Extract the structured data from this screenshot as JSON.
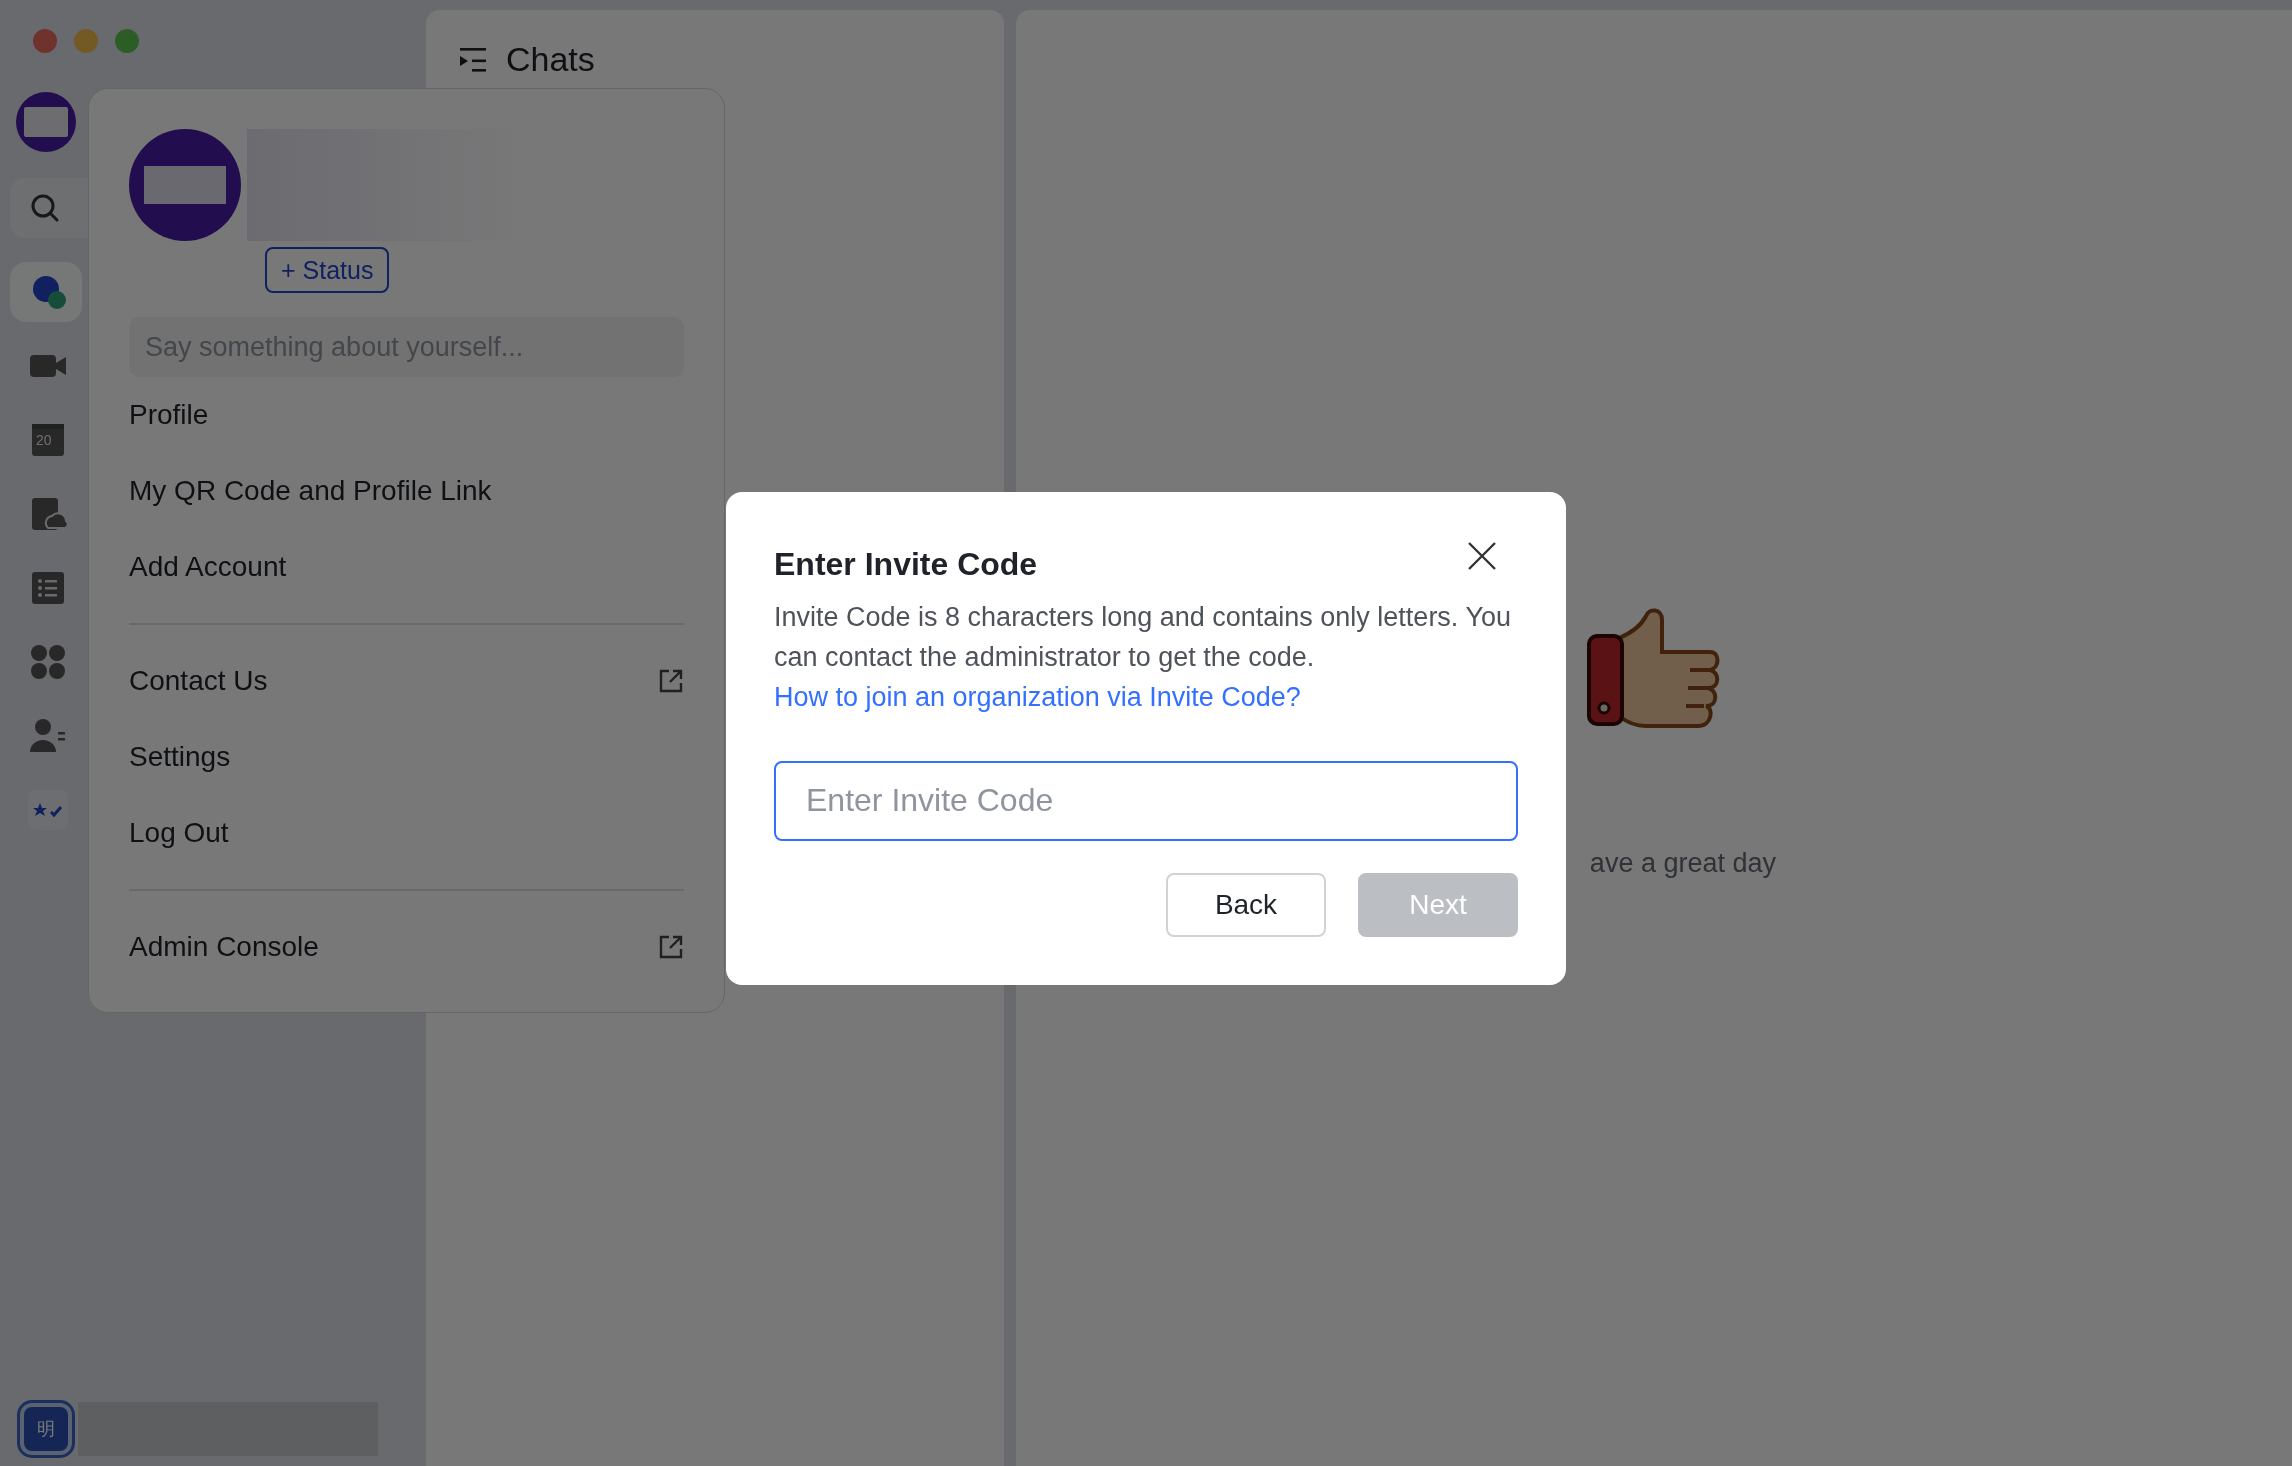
{
  "sidebar": {
    "nav_items": [
      {
        "selected": true
      },
      {
        "selected": false
      },
      {
        "selected": false,
        "icon_text": "20"
      },
      {
        "selected": false
      },
      {
        "selected": false
      },
      {
        "selected": false
      },
      {
        "selected": false
      },
      {
        "selected": false
      }
    ],
    "bottom_avatar_text": "明"
  },
  "chat_panel": {
    "title": "Chats"
  },
  "main": {
    "greeting": "ave a great day"
  },
  "profile_menu": {
    "status_button": "+ Status",
    "bio": {
      "placeholder": "Say something about yourself..."
    },
    "groups": [
      [
        {
          "label": "Profile",
          "external": false
        },
        {
          "label": "My QR Code and Profile Link",
          "external": false
        },
        {
          "label": "Add Account",
          "external": false
        }
      ],
      [
        {
          "label": "Contact Us",
          "external": true
        },
        {
          "label": "Settings",
          "external": false
        },
        {
          "label": "Log Out",
          "external": false
        }
      ],
      [
        {
          "label": "Admin Console",
          "external": true
        }
      ]
    ]
  },
  "dialog": {
    "title": "Enter Invite Code",
    "description": "Invite Code is 8 characters long and contains only letters. You can contact the administrator to get the code.",
    "help_link": "How to join an organization via Invite Code?",
    "input": {
      "placeholder": "Enter Invite Code"
    },
    "buttons": [
      {
        "label": "Back",
        "disabled": false,
        "primary": false
      },
      {
        "label": "Next",
        "disabled": true,
        "primary": true
      }
    ]
  }
}
